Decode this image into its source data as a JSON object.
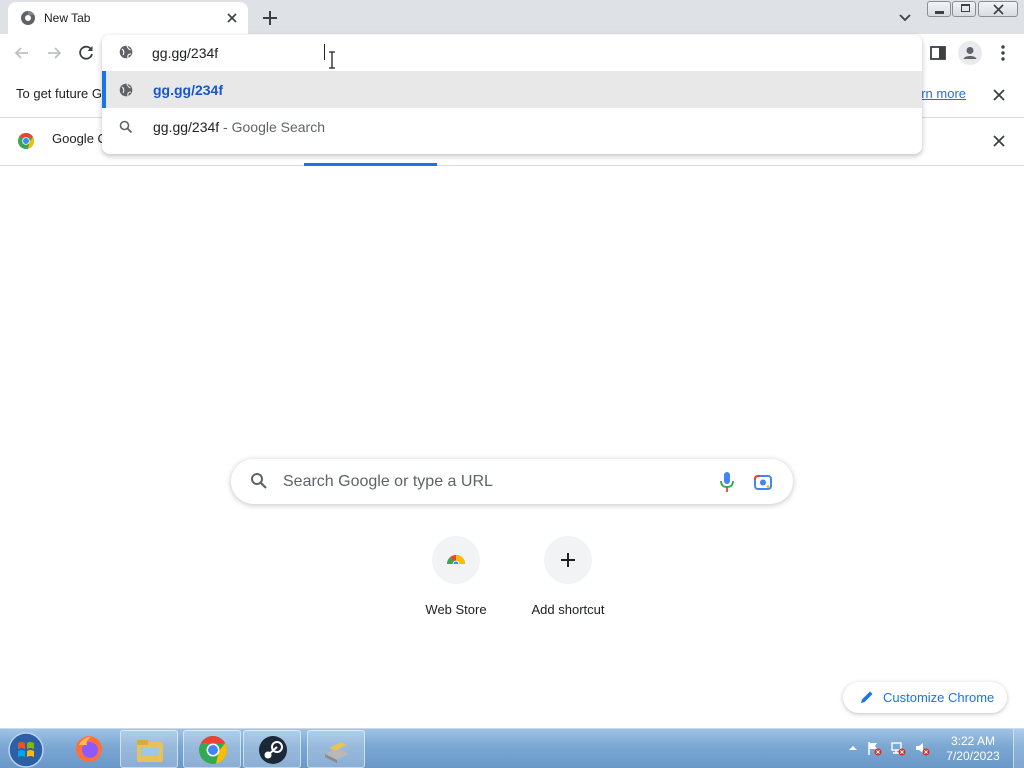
{
  "tab": {
    "title": "New Tab"
  },
  "omnibox": {
    "value": "gg.gg/234f",
    "suggestions": [
      {
        "text": "gg.gg/234f",
        "icon": "globe-icon",
        "selected": true
      },
      {
        "text": "gg.gg/234f",
        "suffix": " - Google Search",
        "icon": "search-icon"
      }
    ]
  },
  "infobar1": {
    "text": "To get future G",
    "link": "arn more"
  },
  "infobar2": {
    "text": "Google C"
  },
  "ntp": {
    "search_placeholder": "Search Google or type a URL",
    "tiles": [
      {
        "label": "Web Store"
      },
      {
        "label": "Add shortcut"
      }
    ],
    "customize_label": "Customize Chrome"
  },
  "taskbar": {
    "time": "3:22 AM",
    "date": "7/20/2023"
  },
  "colors": {
    "accent": "#1a73e8",
    "tabstrip": "#dee1e6"
  }
}
